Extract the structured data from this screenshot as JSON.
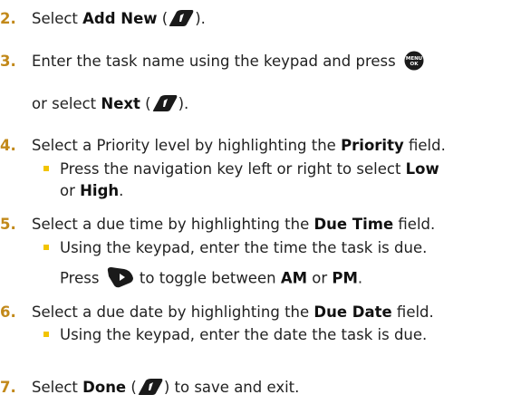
{
  "steps": [
    {
      "num": "2.",
      "pre": "Select ",
      "bold": "Add New",
      "post_open": " (",
      "post_close": ")."
    },
    {
      "num": "3.",
      "text": "Enter the task name using the keypad and press",
      "text_cont_pre": "or select ",
      "text_cont_bold": "Next",
      "text_cont_post_open": " (",
      "text_cont_post_close": ")."
    },
    {
      "num": "4.",
      "pre": "Select a Priority level by highlighting the ",
      "bold": "Priority",
      "post": " field."
    },
    {
      "num": "5.",
      "pre": "Select a due time by highlighting the ",
      "bold": "Due Time",
      "post": " field."
    },
    {
      "num": "6.",
      "pre": "Select a due date by highlighting the ",
      "bold": "Due Date",
      "post": " field."
    },
    {
      "num": "7.",
      "pre": "Select ",
      "bold": "Done",
      "post_open": " (",
      "post_close": ") to save and exit."
    }
  ],
  "subs": {
    "priority_line1_pre": "Press the navigation key left or right to select ",
    "priority_line1_bold": "Low",
    "priority_line2_pre": "or ",
    "priority_line2_bold": "High",
    "priority_line2_post": ".",
    "time_line1": "Using the keypad, enter the time the task is due.",
    "time_line2_pre": "Press ",
    "time_line2_mid": " to toggle between ",
    "time_line2_bold1": "AM",
    "time_line2_or": " or ",
    "time_line2_bold2": "PM",
    "time_line2_post": ".",
    "date_line1": "Using the keypad, enter the date the task is due."
  },
  "icons": {
    "softkey": "right-softkey-icon",
    "menu": "menu-ok-key-icon",
    "menu_label_top": "MENU",
    "menu_label_bottom": "OK",
    "nav": "navigation-key-icon"
  },
  "colors": {
    "step_number": "#c2891a",
    "bullet": "#f2c400",
    "icon_fill": "#1a1a1a"
  }
}
